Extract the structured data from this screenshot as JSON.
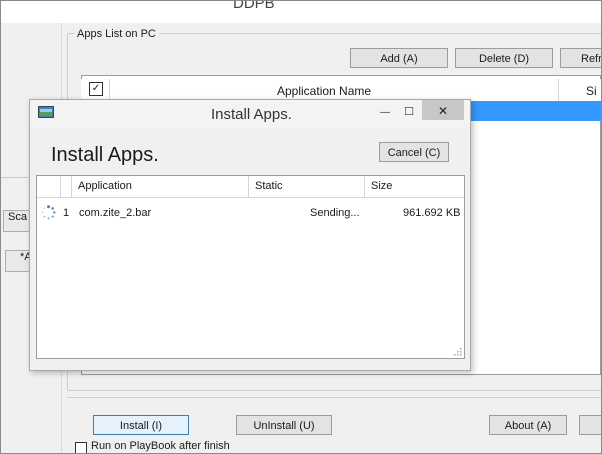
{
  "app_title": "DDPB",
  "group_label": "Apps List on PC",
  "toolbar": {
    "add_label": "Add (A)",
    "delete_label": "Delete (D)",
    "refresh_label": "Refr"
  },
  "app_list": {
    "checkbox_mark": "✓",
    "col_name": "Application Name",
    "col_size_partial": "Si"
  },
  "side_buttons": {
    "scan_label": "Sca",
    "other_label": "*A"
  },
  "bottom": {
    "install_label": "Install (I)",
    "uninstall_label": "UnInstall (U)",
    "about_label": "About (A)",
    "run_label": "Run on PlayBook after finish"
  },
  "dialog": {
    "title": "Install Apps.",
    "heading": "Install Apps.",
    "cancel_label": "Cancel (C)",
    "minimize": "—",
    "maximize": "☐",
    "close": "✕",
    "columns": [
      "Application",
      "Static",
      "Size"
    ],
    "rows": [
      {
        "index": "1",
        "application": "com.zite_2.bar",
        "status": "Sending...",
        "size": "961.692 KB"
      }
    ]
  },
  "colors": {
    "selection": "#3399ff",
    "window_bg": "#f0f0f0",
    "close_btn": "#c7c7c7"
  }
}
